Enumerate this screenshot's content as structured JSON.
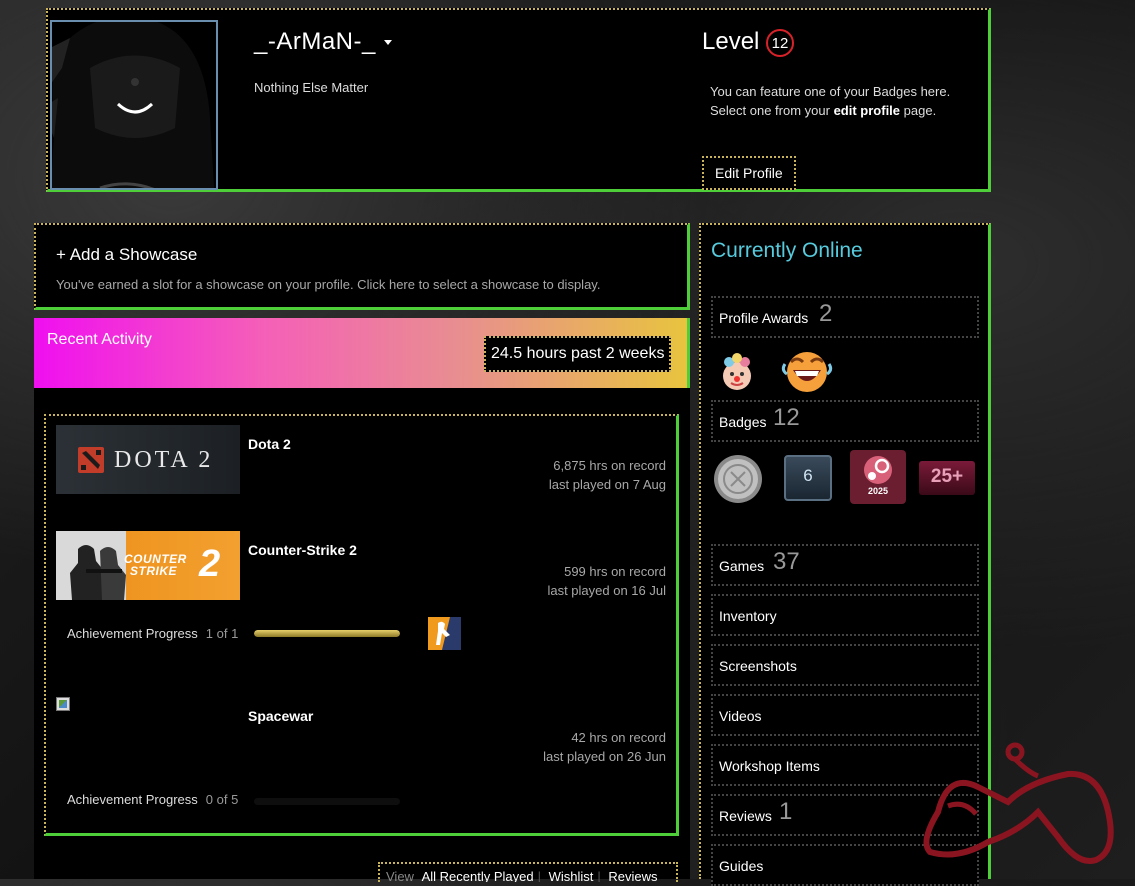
{
  "profile": {
    "persona_name": "_-ArMaN-_",
    "summary": "Nothing Else Matter",
    "level_label": "Level",
    "level": "12",
    "feature_line1": "You can feature one of your Badges here.",
    "feature_line2_prefix": "Select one from your",
    "feature_line2_link": "edit profile",
    "feature_line2_suffix": "page.",
    "edit_profile_label": "Edit Profile"
  },
  "showcase": {
    "title": "+ Add a Showcase",
    "description": "You've earned a slot for a showcase on your profile. Click here to select a showcase to display."
  },
  "activity": {
    "title": "Recent Activity",
    "hours": "24.5 hours past 2 weeks",
    "games": [
      {
        "name": "Dota 2",
        "hours": "6,875 hrs on record",
        "last_played": "last played on 7 Aug",
        "capsule_text": "DOTA 2"
      },
      {
        "name": "Counter-Strike 2",
        "hours": "599 hrs on record",
        "last_played": "last played on 16 Jul",
        "capsule_text_1": "COUNTER",
        "capsule_text_2": "STRIKE",
        "capsule_num": "2",
        "achievement_label": "Achievement Progress",
        "achievement_count": "1 of 1",
        "achievement_fraction": 1.0
      },
      {
        "name": "Spacewar",
        "hours": "42 hrs on record",
        "last_played": "last played on 26 Jun",
        "achievement_label": "Achievement Progress",
        "achievement_count": "0 of 5",
        "achievement_fraction": 0.0
      }
    ],
    "view_label": "View",
    "view_links": [
      "All Recently Played",
      "Wishlist",
      "Reviews"
    ]
  },
  "sidebar": {
    "status": "Currently Online",
    "profile_awards_label": "Profile Awards",
    "profile_awards_count": "2",
    "badges_label": "Badges",
    "badges_count": "12",
    "badge_year": "2025",
    "badge_level_text": "25+",
    "badge_six": "6",
    "games_label": "Games",
    "games_count": "37",
    "items": [
      {
        "label": "Inventory",
        "count": ""
      },
      {
        "label": "Screenshots",
        "count": ""
      },
      {
        "label": "Videos",
        "count": ""
      },
      {
        "label": "Workshop Items",
        "count": ""
      },
      {
        "label": "Reviews",
        "count": "1"
      },
      {
        "label": "Guides",
        "count": ""
      }
    ]
  },
  "colors": {
    "accent_green": "#4ecf3a",
    "dotted_gold": "#c8b25a",
    "online_blue": "#57cbde",
    "level_red": "#d8222a"
  }
}
